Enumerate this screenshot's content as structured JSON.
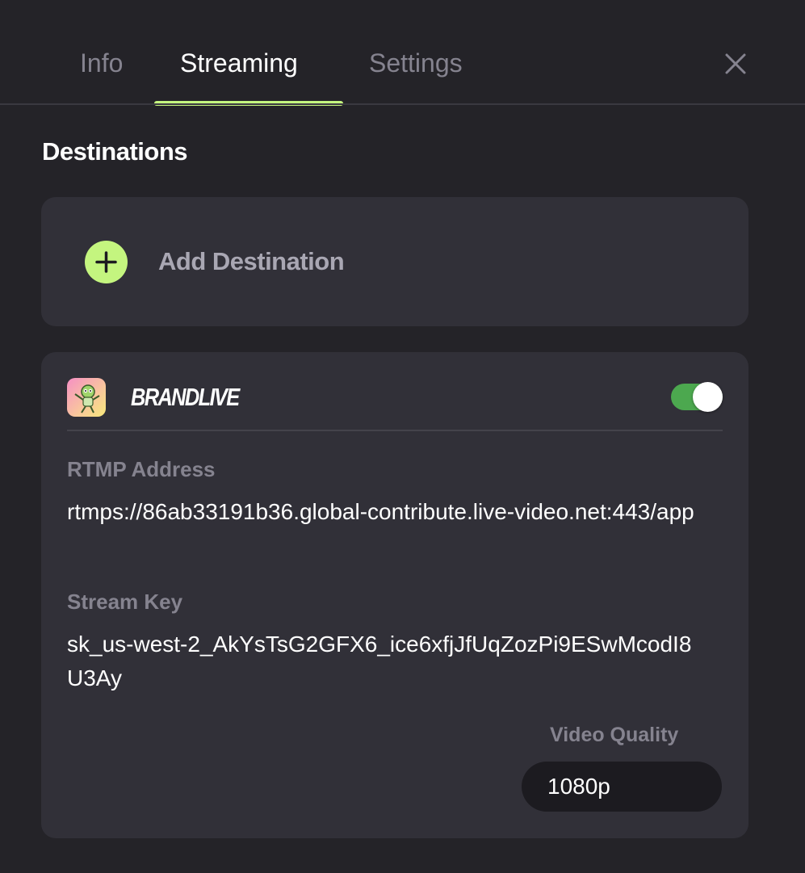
{
  "tabs": {
    "info": "Info",
    "streaming": "Streaming",
    "settings": "Settings"
  },
  "close_icon": "close-icon",
  "section_title": "Destinations",
  "add_destination": {
    "label": "Add Destination",
    "icon": "plus-circle-icon"
  },
  "destination": {
    "logo_icon": "brandlive-app-icon",
    "name": "BRANDLIVE",
    "enabled": true,
    "rtmp_label": "RTMP Address",
    "rtmp_value": "rtmps://86ab33191b36.global-contribute.live-video.net:443/app",
    "stream_key_label": "Stream Key",
    "stream_key_value": "sk_us-west-2_AkYsTsG2GFX6_ice6xfjJfUqZozPi9ESwMcodI8U3Ay",
    "video_quality_label": "Video Quality",
    "video_quality_value": "1080p"
  },
  "colors": {
    "background": "#242328",
    "card": "#313038",
    "accent": "#c4f57f",
    "toggle_on": "#4ca84f",
    "muted_text": "#85838f"
  }
}
